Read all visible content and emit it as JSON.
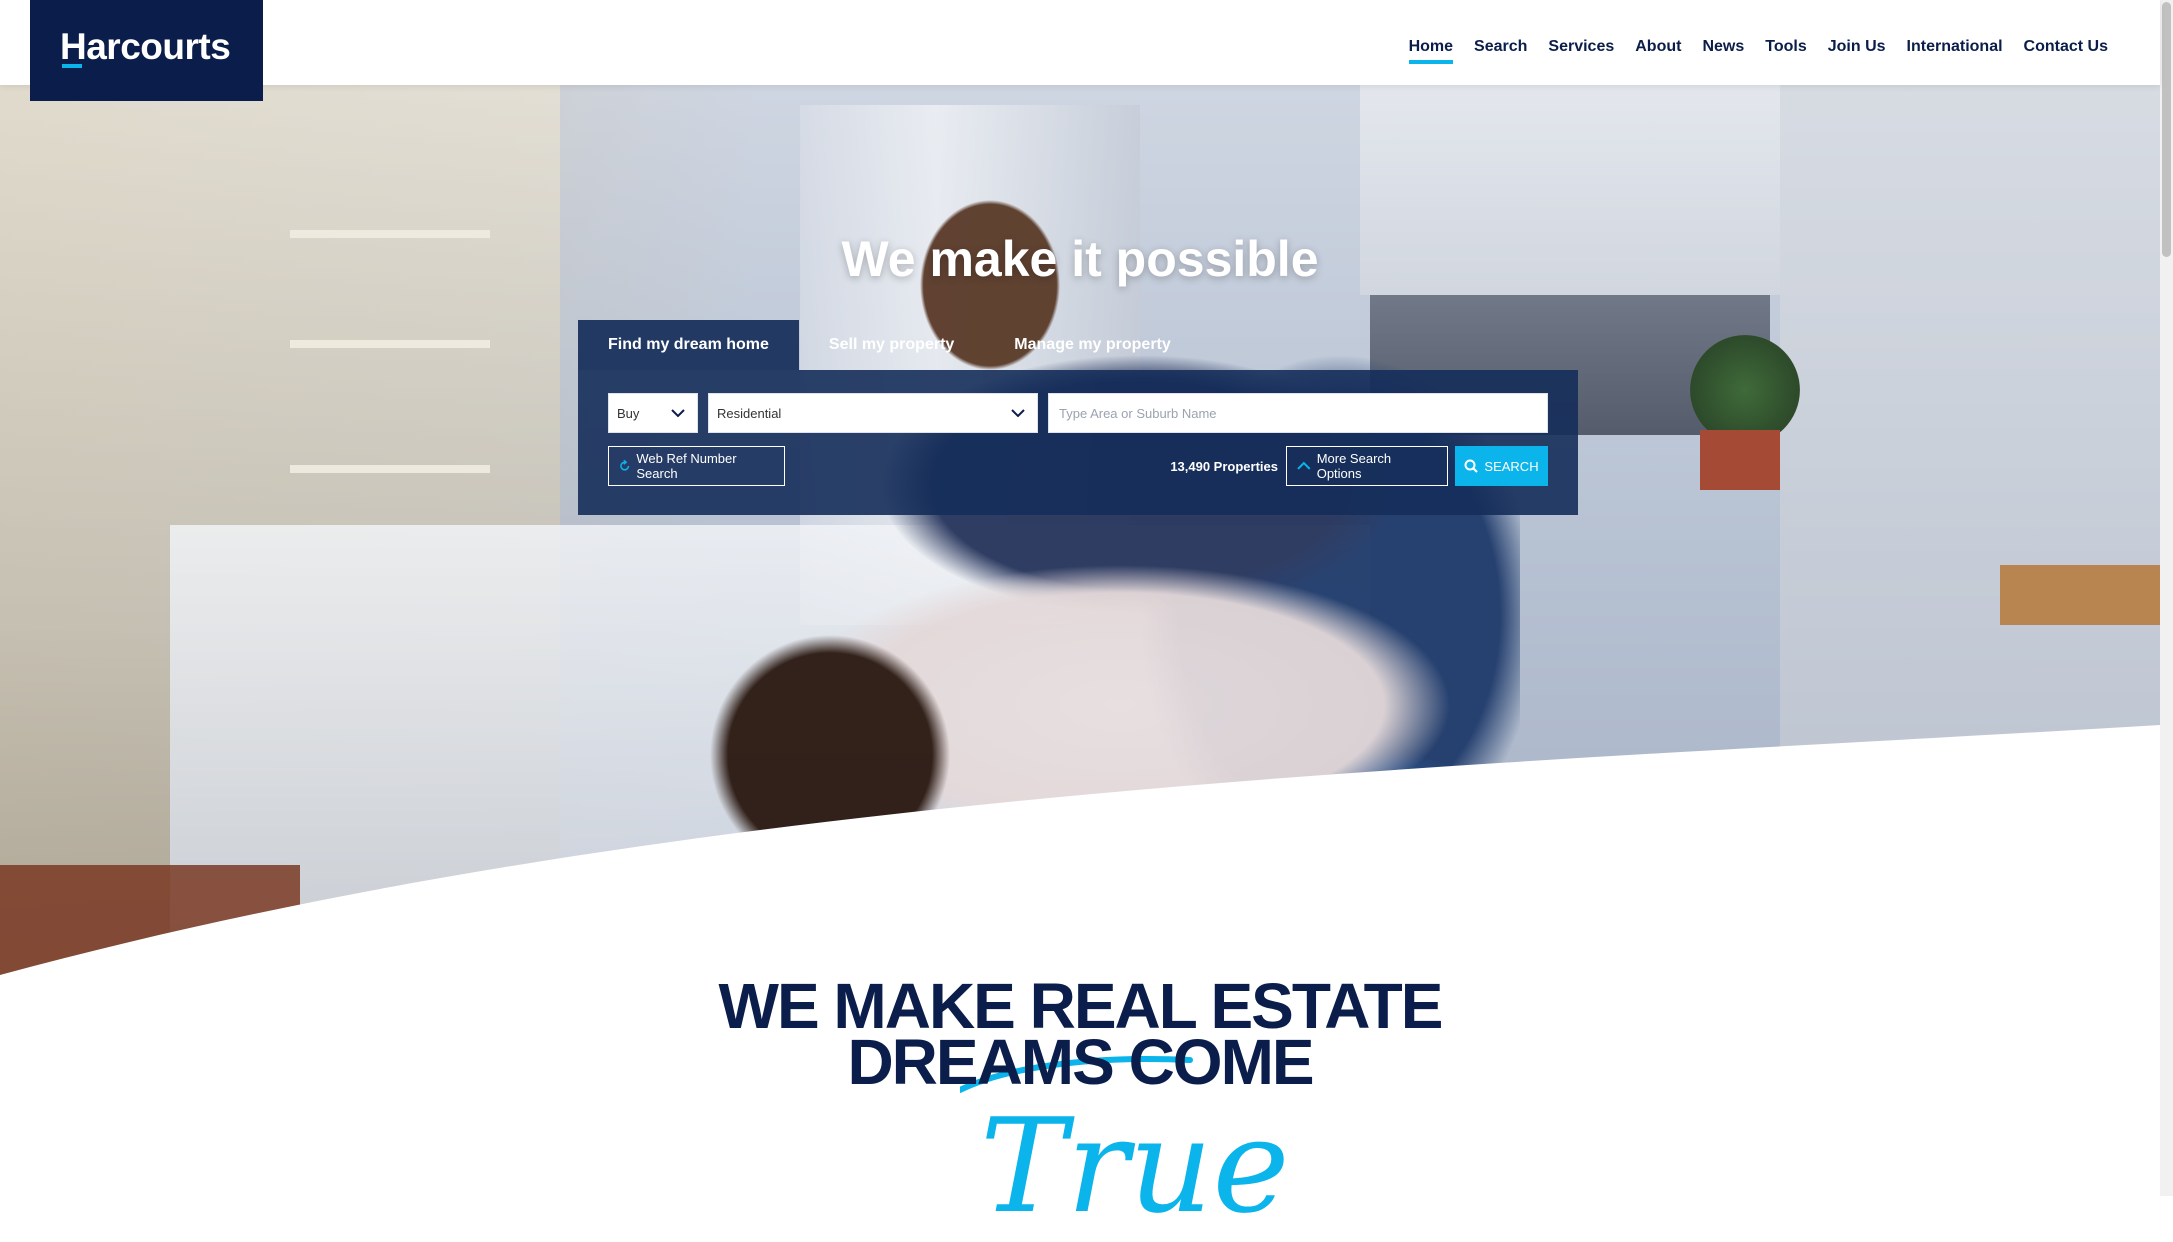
{
  "brand": {
    "name": "Harcourts",
    "primary_color": "#0b1d4a",
    "accent_color": "#0bb4ea"
  },
  "nav": {
    "items": [
      {
        "label": "Home",
        "active": true
      },
      {
        "label": "Search"
      },
      {
        "label": "Services"
      },
      {
        "label": "About"
      },
      {
        "label": "News"
      },
      {
        "label": "Tools"
      },
      {
        "label": "Join Us"
      },
      {
        "label": "International"
      },
      {
        "label": "Contact Us"
      }
    ]
  },
  "hero": {
    "title": "We make it possible"
  },
  "search": {
    "tabs": [
      {
        "label": "Find my dream home",
        "active": true
      },
      {
        "label": "Sell my property"
      },
      {
        "label": "Manage my property"
      }
    ],
    "listing_type": "Buy",
    "property_type": "Residential",
    "area_placeholder": "Type Area or Suburb Name",
    "web_ref_label": "Web Ref Number Search",
    "properties_count": "13,490 Properties",
    "more_options_label": "More Search Options",
    "search_label": "SEARCH",
    "icons": {
      "web_ref": "refresh-icon",
      "more_options": "chevron-up-icon",
      "search": "search-icon",
      "dropdown": "chevron-down-icon"
    }
  },
  "tagline": {
    "line1": "WE MAKE REAL ESTATE",
    "line2": "DREAMS COME",
    "script": "True"
  }
}
